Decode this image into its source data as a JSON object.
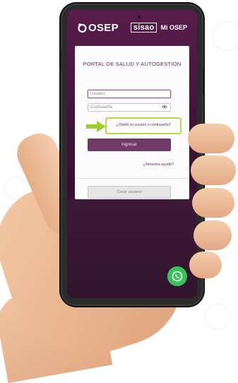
{
  "header": {
    "logo_text": "OSEP",
    "sisao_text": "sisao",
    "mi_osep_text": "Mi OSEP"
  },
  "card": {
    "title": "PORTAL DE SALUD Y AUTOGESTIÓN",
    "username_placeholder": "Usuario",
    "password_placeholder": "Contraseña",
    "forgot_link": "¿Olvidó su usuario o contraseña?",
    "login_button": "Ingresar",
    "help_link": "¿Necesita ayuda?",
    "create_user_button": "Crear usuario"
  },
  "colors": {
    "brand_purple": "#5a1c4d",
    "button_purple": "#6f3a66",
    "highlight_green": "#b5da45",
    "whatsapp_green": "#36c35a"
  },
  "icons": {
    "logo": "osep-logo-icon",
    "password_toggle": "eye-icon",
    "arrow": "arrow-right-icon",
    "chat": "whatsapp-icon"
  }
}
